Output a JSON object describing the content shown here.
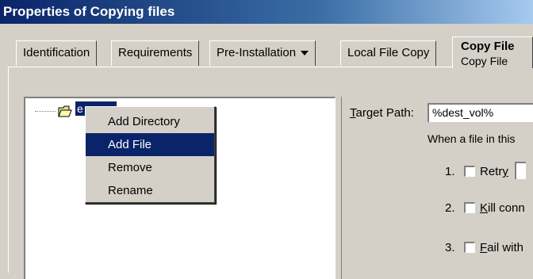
{
  "window": {
    "title": "Properties of Copying files"
  },
  "tabs": [
    {
      "label": "Identification"
    },
    {
      "label": "Requirements"
    },
    {
      "label": "Pre-Installation"
    },
    {
      "label": "Local File Copy"
    },
    {
      "label": "Copy File",
      "sublabel": "Copy File",
      "active": true
    }
  ],
  "tree": {
    "root_label": "e"
  },
  "context_menu": {
    "items": [
      {
        "label": "Add Directory"
      },
      {
        "label": "Add File",
        "selected": true
      },
      {
        "label": "Remove"
      },
      {
        "label": "Rename"
      }
    ]
  },
  "right_panel": {
    "target_path_label_prefix": "T",
    "target_path_label_rest": "arget Path:",
    "target_path_value": "%dest_vol%",
    "when_text": "When a file in this",
    "options": [
      {
        "num": "1.",
        "label_prefix": "Retr",
        "label_accel": "y",
        "label_rest": ""
      },
      {
        "num": "2.",
        "label_prefix": "",
        "label_accel": "K",
        "label_rest": "ill conn"
      },
      {
        "num": "3.",
        "label_prefix": "",
        "label_accel": "F",
        "label_rest": "ail with"
      }
    ]
  },
  "colors": {
    "title_bar": "#0a246a",
    "selection": "#0a246a",
    "face": "#d4d0c8"
  }
}
